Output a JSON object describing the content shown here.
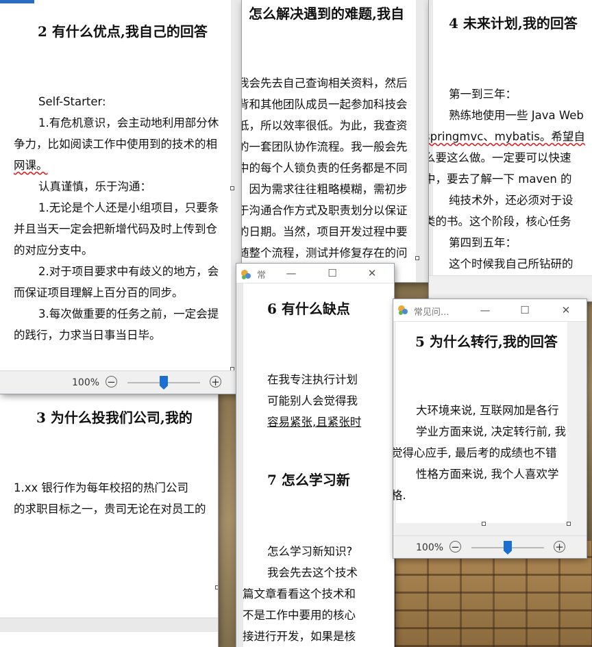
{
  "windows": {
    "w2": {
      "heading": "2  有什么优点,我自己的回答",
      "lines": [
        {
          "t": "Self-Starter:",
          "i": true
        },
        {
          "t": "1.有危机意识，会主动地利用部分休",
          "i": true
        },
        {
          "t": "争力，比如阅读工作中使用到的技术的相",
          "i": false
        },
        {
          "t": "网课。",
          "i": false
        },
        {
          "t": "",
          "i": false
        },
        {
          "t": "认真谨慎，乐于沟通：",
          "i": true
        },
        {
          "t": "1.无论是个人还是小组项目，只要条",
          "i": true
        },
        {
          "t": "并且当天一定会把新增代码及时上传到仓",
          "i": false
        },
        {
          "t": "的对应分支中。",
          "i": false
        },
        {
          "t": "2.对于项目要求中有歧义的地方，会",
          "i": true
        },
        {
          "t": "而保证项目理解上百分百的同步。",
          "i": false
        },
        {
          "t": "3.每次做重要的任务之前，一定会提",
          "i": true
        },
        {
          "t": "的践行，力求当日事当日毕。",
          "i": false
        }
      ],
      "zoom": "100%"
    },
    "w_top": {
      "heading": "怎么解决遇到的难题,我自",
      "lines": [
        "我会先去自己查询相关资料，然后",
        "背和其他团队成员一起参加科技会",
        "低，所以效率很低。为此，我查资",
        "的一套团队协作流程。我一般会先",
        "中的每个人锁负责的任务都是不同",
        "，因为需求往往粗略模糊，需初步",
        "于沟通合作方式及职责划分以保证",
        "的日期。当然，项目开发过程中要",
        "随整个流程，测试并修复存在的问"
      ],
      "title": "常"
    },
    "w4": {
      "heading": "4  未来计划,我的回答",
      "lines": [
        {
          "t": "第一到三年：",
          "i": true
        },
        {
          "t": "熟练地使用一些 Java Web",
          "i": true
        },
        {
          "t": "springmvc、mybatis。希望自",
          "i": false
        },
        {
          "t": "么要这么做。一定要可以快速",
          "i": false
        },
        {
          "t": "中，要去了解一下 maven 的",
          "i": false
        },
        {
          "t": "纯技术外，还必须对于设",
          "i": true
        },
        {
          "t": "类的书。这个阶段，核心任务",
          "i": false
        },
        {
          "t": "",
          "i": false
        },
        {
          "t": "第四到五年：",
          "i": true
        },
        {
          "t": "这个时候我自己所钻研的",
          "i": true
        }
      ]
    },
    "w3": {
      "heading": "3  为什么投我们公司,我的",
      "lines": [
        "1.xx 银行作为每年校招的热门公司",
        "的求职目标之一，贵司无论在对员工的"
      ]
    },
    "w6": {
      "heading6": "6  有什么缺点",
      "lines6": [
        "在我专注执行计划",
        "可能别人会觉得我",
        "容易紧张,且紧张时"
      ],
      "heading7": "7  怎么学习新",
      "lines7": [
        {
          "t": "怎么学习新知识?",
          "i": true
        },
        {
          "t": "我会先去这个技术",
          "i": true
        },
        {
          "t": "篇文章看看这个技术和",
          "i": false
        },
        {
          "t": "不是工作中要用的核心",
          "i": false
        },
        {
          "t": "接进行开发，如果是核",
          "i": false
        }
      ]
    },
    "w5": {
      "title": "常见问...",
      "heading": "5  为什么转行,我的回答",
      "lines": [
        {
          "t": "大环境来说, 互联网加是各行",
          "i": true
        },
        {
          "t": "学业方面来说, 决定转行前, 我",
          "i": true
        },
        {
          "t": "觉得心应手, 最后考的成绩也不错",
          "i": false
        },
        {
          "t": "性格方面来说, 我个人喜欢学",
          "i": true
        },
        {
          "t": "格.",
          "i": false
        }
      ],
      "zoom": "100%"
    }
  },
  "icons": {
    "minimize": "—",
    "maximize": "☐",
    "close": "✕",
    "zoom_out": "−",
    "zoom_in": "+"
  }
}
